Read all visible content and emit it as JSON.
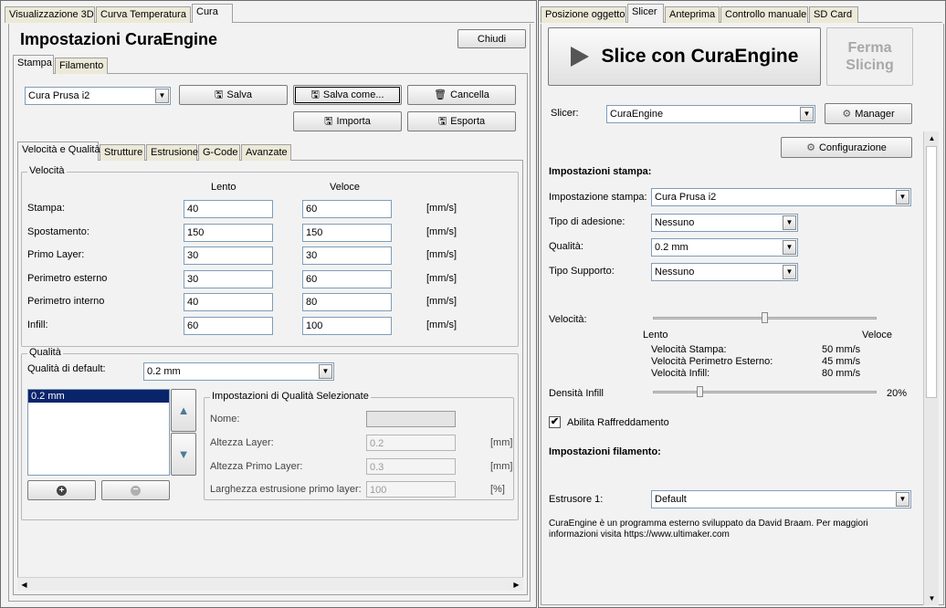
{
  "left_tabs": [
    "Visualizzazione 3D",
    "Curva Temperatura",
    "Cura"
  ],
  "settings_title": "Impostazioni CuraEngine",
  "close_label": "Chiudi",
  "sub_tabs": [
    "Stampa",
    "Filamento"
  ],
  "profile": {
    "selected": "Cura Prusa i2",
    "save": "Salva",
    "save_as": "Salva come...",
    "delete": "Cancella",
    "import": "Importa",
    "export": "Esporta"
  },
  "inner_tabs": [
    "Velocità e Qualità",
    "Strutture",
    "Estrusione",
    "G-Code",
    "Avanzate"
  ],
  "speed": {
    "group_title": "Velocità",
    "col_slow": "Lento",
    "col_fast": "Veloce",
    "unit": "[mm/s]",
    "rows": [
      {
        "label": "Stampa:",
        "slow": "40",
        "fast": "60"
      },
      {
        "label": "Spostamento:",
        "slow": "150",
        "fast": "150"
      },
      {
        "label": "Primo Layer:",
        "slow": "30",
        "fast": "30"
      },
      {
        "label": "Perimetro esterno",
        "slow": "30",
        "fast": "60"
      },
      {
        "label": "Perimetro interno",
        "slow": "40",
        "fast": "80"
      },
      {
        "label": "Infill:",
        "slow": "60",
        "fast": "100"
      }
    ]
  },
  "quality": {
    "group_title": "Qualità",
    "default_label": "Qualità di default:",
    "default_value": "0.2 mm",
    "list_items": [
      "0.2 mm"
    ],
    "selected_group_title": "Impostazioni di Qualità Selezionate",
    "name_label": "Nome:",
    "name_value": "",
    "layer_height_label": "Altezza Layer:",
    "layer_height_value": "0.2",
    "layer_height_unit": "[mm]",
    "first_layer_label": "Altezza Primo Layer:",
    "first_layer_value": "0.3",
    "first_layer_unit": "[mm]",
    "extrusion_width_label": "Larghezza estrusione primo layer:",
    "extrusion_width_value": "100",
    "extrusion_width_unit": "[%]"
  },
  "right_tabs": [
    "Posizione oggetto",
    "Slicer",
    "Anteprima",
    "Controllo manuale",
    "SD Card"
  ],
  "slice_button": "Slice con CuraEngine",
  "stop_button_line1": "Ferma",
  "stop_button_line2": "Slicing",
  "slicer": {
    "label": "Slicer:",
    "value": "CuraEngine",
    "manager": "Manager",
    "config": "Configurazione"
  },
  "print_settings": {
    "title": "Impostazioni stampa:",
    "print_setting_label": "Impostazione stampa:",
    "print_setting_value": "Cura Prusa i2",
    "adhesion_label": "Tipo di adesione:",
    "adhesion_value": "Nessuno",
    "quality_label": "Qualità:",
    "quality_value": "0.2 mm",
    "support_label": "Tipo Supporto:",
    "support_value": "Nessuno",
    "speed_label": "Velocità:",
    "speed_slider_fraction": 0.5,
    "slow": "Lento",
    "fast": "Veloce",
    "speed_print_label": "Velocità Stampa:",
    "speed_print_value": "50 mm/s",
    "speed_perimeter_label": "Velocità Perimetro Esterno:",
    "speed_perimeter_value": "45 mm/s",
    "speed_infill_label": "Velocità Infill:",
    "speed_infill_value": "80 mm/s",
    "infill_label": "Densità Infill",
    "infill_value": "20%",
    "infill_fraction": 0.2,
    "cooling_label": "Abilita Raffreddamento",
    "cooling_checked": true
  },
  "filament_settings": {
    "title": "Impostazioni filamento:",
    "extruder_label": "Estrusore 1:",
    "extruder_value": "Default"
  },
  "info_line1": "CuraEngine è un programma esterno sviluppato da David Braam. Per maggiori",
  "info_line2": "informazioni visita https://www.ultimaker.com"
}
